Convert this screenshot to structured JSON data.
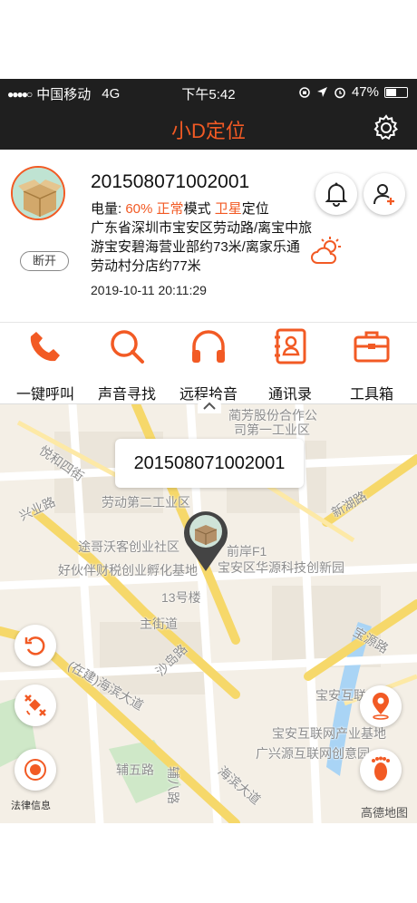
{
  "status_bar": {
    "signal_dots": "●●●●○",
    "carrier": "中国移动",
    "network": "4G",
    "time": "下午5:42",
    "battery": "47%",
    "battery_level": 0.47
  },
  "navbar": {
    "title": "小D定位",
    "settings_icon": "gear-icon"
  },
  "device": {
    "id": "201508071002001",
    "power_label": "电量: ",
    "power_value": "60%",
    "mode_value": "正常",
    "mode_suffix": "模式",
    "locate_value": "卫星",
    "locate_suffix": "定位",
    "address": "广东省深圳市宝安区劳动路/离宝中旅游宝安碧海营业部约73米/离家乐通劳动村分店约77米",
    "timestamp": "2019-10-11 20:11:29",
    "status_badge": "断开"
  },
  "quick_actions": [
    {
      "label": "一键呼叫",
      "icon": "phone-icon"
    },
    {
      "label": "声音寻找",
      "icon": "search-icon"
    },
    {
      "label": "远程拾音",
      "icon": "headphones-icon"
    },
    {
      "label": "通讯录",
      "icon": "contacts-icon"
    },
    {
      "label": "工具箱",
      "icon": "toolbox-icon"
    }
  ],
  "map": {
    "callout": "201508071002001",
    "labels": {
      "l1": "蔺芳股份合作公",
      "l2": "司第一工业区",
      "l3": "兴业路",
      "l4": "劳动第二工业区",
      "l5": "途哥沃客创业社区",
      "l6": "好伙伴财税创业孵化基地",
      "l7": "宝安区华源科技创新园",
      "l8": "13号楼",
      "l9": "主街道",
      "l10": "宝安互联",
      "l11": "宝安互联网产业基地",
      "l12": "广兴源互联网创意园",
      "l13": "新湖路",
      "l14": "宝源路",
      "l15": "海滨大道",
      "l16": "悦和四街",
      "l17": "辅五路",
      "l18": "辅八路",
      "l19": "(在建)海滨大道",
      "l20": "前岸F1",
      "l21": "沙岛路"
    },
    "legal": "法律信息",
    "brand": "高德地图"
  },
  "colors": {
    "accent": "#f25a24",
    "bar": "#1f1f1f"
  }
}
